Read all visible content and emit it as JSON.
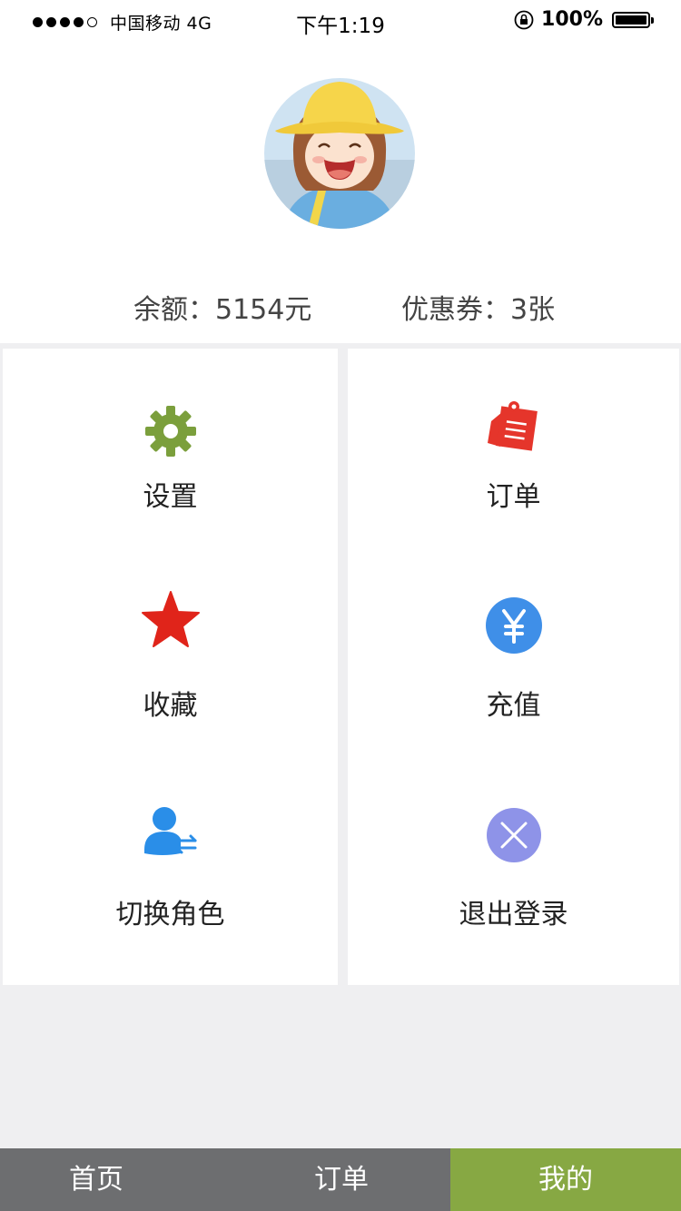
{
  "status_bar": {
    "carrier": "中国移动 4G",
    "time": "下午1:19",
    "battery": "100%"
  },
  "profile": {
    "balance": "余额：5154元",
    "coupons": "优惠券：3张"
  },
  "menu": {
    "settings": {
      "label": "设置",
      "icon": "gear-icon",
      "color": "#7b9f3c"
    },
    "orders": {
      "label": "订单",
      "icon": "order-note-icon",
      "color": "#e5352b"
    },
    "favorites": {
      "label": "收藏",
      "icon": "star-icon",
      "color": "#e0241a"
    },
    "recharge": {
      "label": "充值",
      "icon": "yen-icon",
      "color": "#3f8fe8"
    },
    "switch_role": {
      "label": "切换角色",
      "icon": "user-switch-icon",
      "color": "#2a8ee8"
    },
    "logout": {
      "label": "退出登录",
      "icon": "close-circle-icon",
      "color": "#8e93e8"
    }
  },
  "tabbar": {
    "home": "首页",
    "orders": "订单",
    "mine": "我的",
    "active": "mine",
    "active_color": "#87a843"
  }
}
